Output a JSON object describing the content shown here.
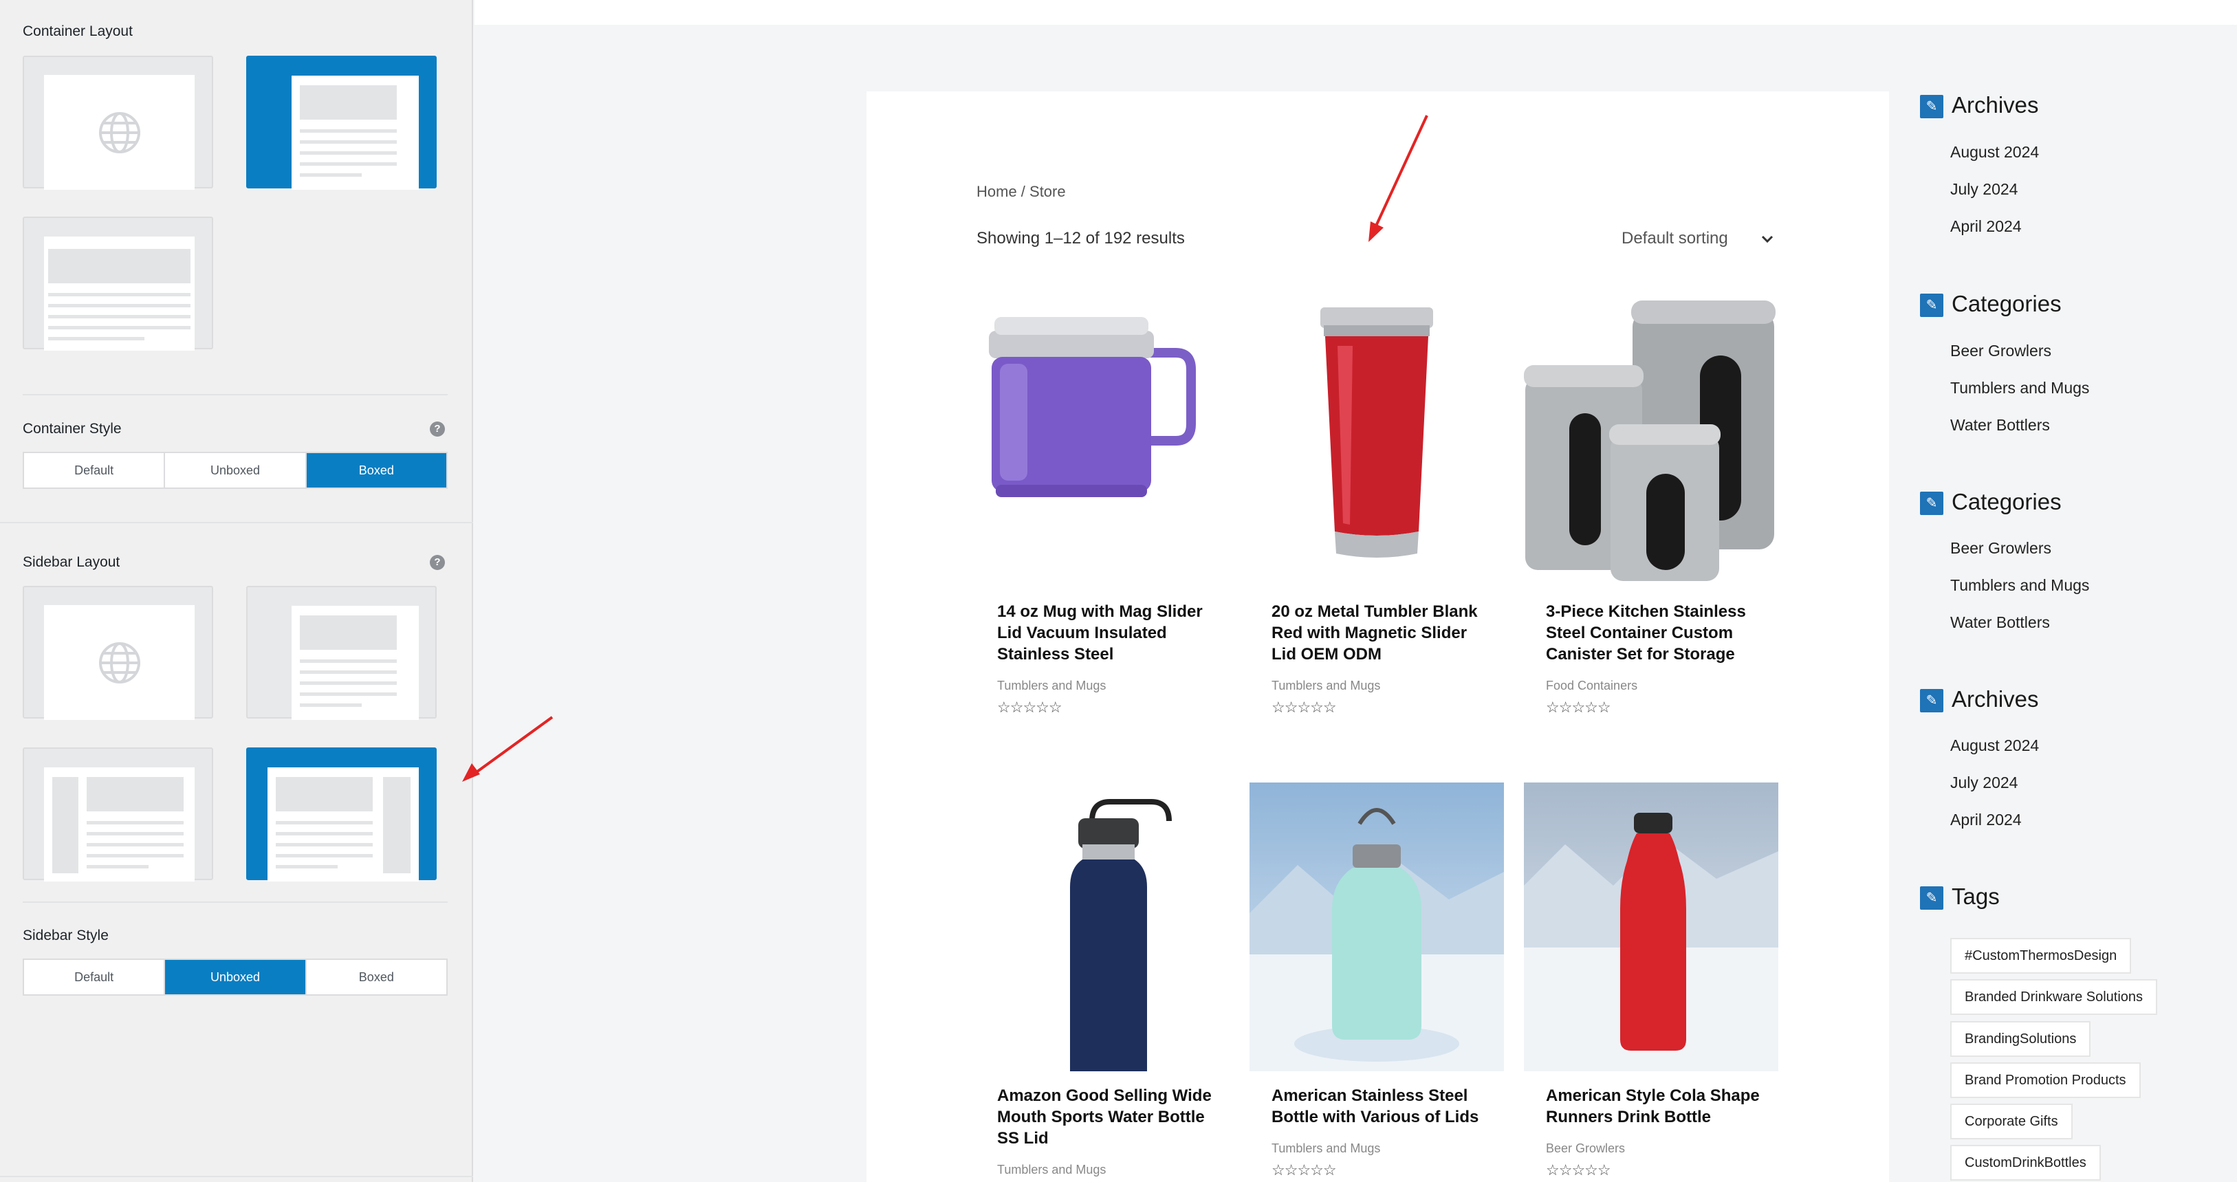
{
  "panel": {
    "container_layout": {
      "title": "Container Layout",
      "options": [
        "full-width",
        "boxed",
        "wide"
      ],
      "selected": "boxed"
    },
    "container_style": {
      "title": "Container Style",
      "options": [
        "Default",
        "Unboxed",
        "Boxed"
      ],
      "selected": "Boxed"
    },
    "sidebar_layout": {
      "title": "Sidebar Layout",
      "options": [
        "default",
        "no-sidebar",
        "left-sidebar",
        "right-sidebar"
      ],
      "selected": "right-sidebar"
    },
    "sidebar_style": {
      "title": "Sidebar Style",
      "options": [
        "Default",
        "Unboxed",
        "Boxed"
      ],
      "selected": "Unboxed"
    },
    "help_glyph": "?"
  },
  "store": {
    "breadcrumb": "Home / Store",
    "results": "Showing 1–12 of 192 results",
    "sorting": "Default sorting",
    "stars": "☆☆☆☆☆",
    "products": [
      {
        "title": "14 oz Mug with Mag Slider Lid Vacuum Insulated Stainless Steel",
        "category": "Tumblers and Mugs"
      },
      {
        "title": "20 oz Metal Tumbler Blank Red with Magnetic Slider Lid OEM ODM",
        "category": "Tumblers and Mugs"
      },
      {
        "title": "3-Piece Kitchen Stainless Steel Container Custom Canister Set for Storage",
        "category": "Food Containers"
      },
      {
        "title": "Amazon Good Selling Wide Mouth Sports Water Bottle SS Lid",
        "category": "Tumblers and Mugs"
      },
      {
        "title": "American Stainless Steel Bottle with Various of Lids",
        "category": "Tumblers and Mugs"
      },
      {
        "title": "American Style Cola Shape Runners Drink Bottle",
        "category": "Beer Growlers"
      }
    ]
  },
  "sidebar": {
    "widgets": [
      {
        "title": "Archives",
        "items": [
          "August 2024",
          "July 2024",
          "April 2024"
        ]
      },
      {
        "title": "Categories",
        "items": [
          "Beer Growlers",
          "Tumblers and Mugs",
          "Water Bottlers"
        ]
      },
      {
        "title": "Categories",
        "items": [
          "Beer Growlers",
          "Tumblers and Mugs",
          "Water Bottlers"
        ]
      },
      {
        "title": "Archives",
        "items": [
          "August 2024",
          "July 2024",
          "April 2024"
        ]
      }
    ],
    "tags_title": "Tags",
    "tags": [
      "#CustomThermosDesign",
      "Branded Drinkware Solutions",
      "BrandingSolutions",
      "Brand Promotion Products",
      "Corporate Gifts",
      "CustomDrinkBottles"
    ],
    "widget_icon": "pencil-square-icon"
  },
  "colors": {
    "accent": "#0a7ec2",
    "annotation_arrow": "#e32424",
    "widget_icon": "#1f73b7"
  }
}
